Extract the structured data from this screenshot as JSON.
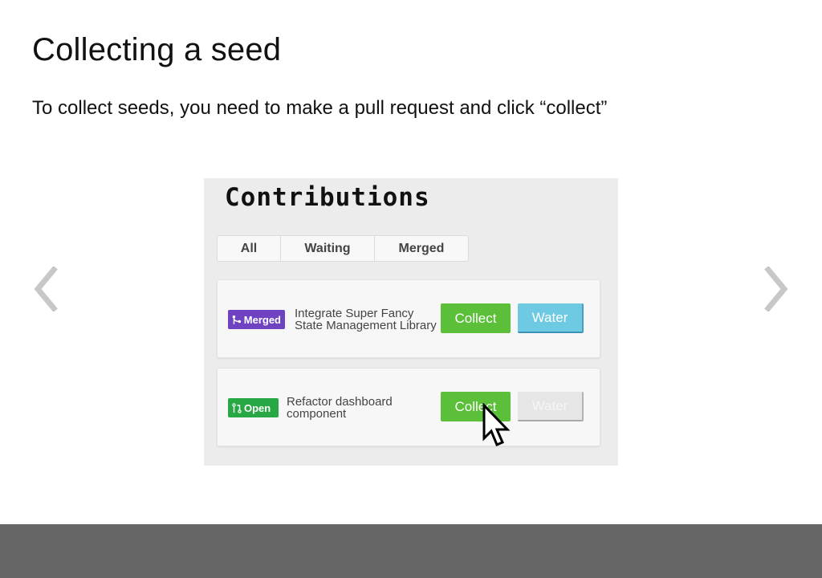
{
  "slide": {
    "title": "Collecting a seed",
    "subtitle": "To collect seeds, you need to make a pull request and click “collect”"
  },
  "navigation": {
    "prev_icon": "chevron-left-icon",
    "next_icon": "chevron-right-icon"
  },
  "screenshot": {
    "title": "Contributions",
    "tabs": [
      {
        "label": "All"
      },
      {
        "label": "Waiting"
      },
      {
        "label": "Merged"
      }
    ],
    "contributions": [
      {
        "status": "Merged",
        "status_icon": "merge-icon",
        "status_color": "#6f42c1",
        "title_line1": "Integrate Super Fancy",
        "title_line2": "State Management Library",
        "collect_label": "Collect",
        "water_label": "Water",
        "water_enabled": true
      },
      {
        "status": "Open",
        "status_icon": "pull-request-icon",
        "status_color": "#28a745",
        "title_line1": "Refactor dashboard",
        "title_line2": "component",
        "collect_label": "Collect",
        "water_label": "Water",
        "water_enabled": false
      }
    ],
    "cursor_icon": "mouse-pointer-icon"
  },
  "colors": {
    "collect_button": "#5bbf3a",
    "water_button": "#6ec9e3",
    "footer_bar": "#666666",
    "arrows": "#cccccc"
  }
}
